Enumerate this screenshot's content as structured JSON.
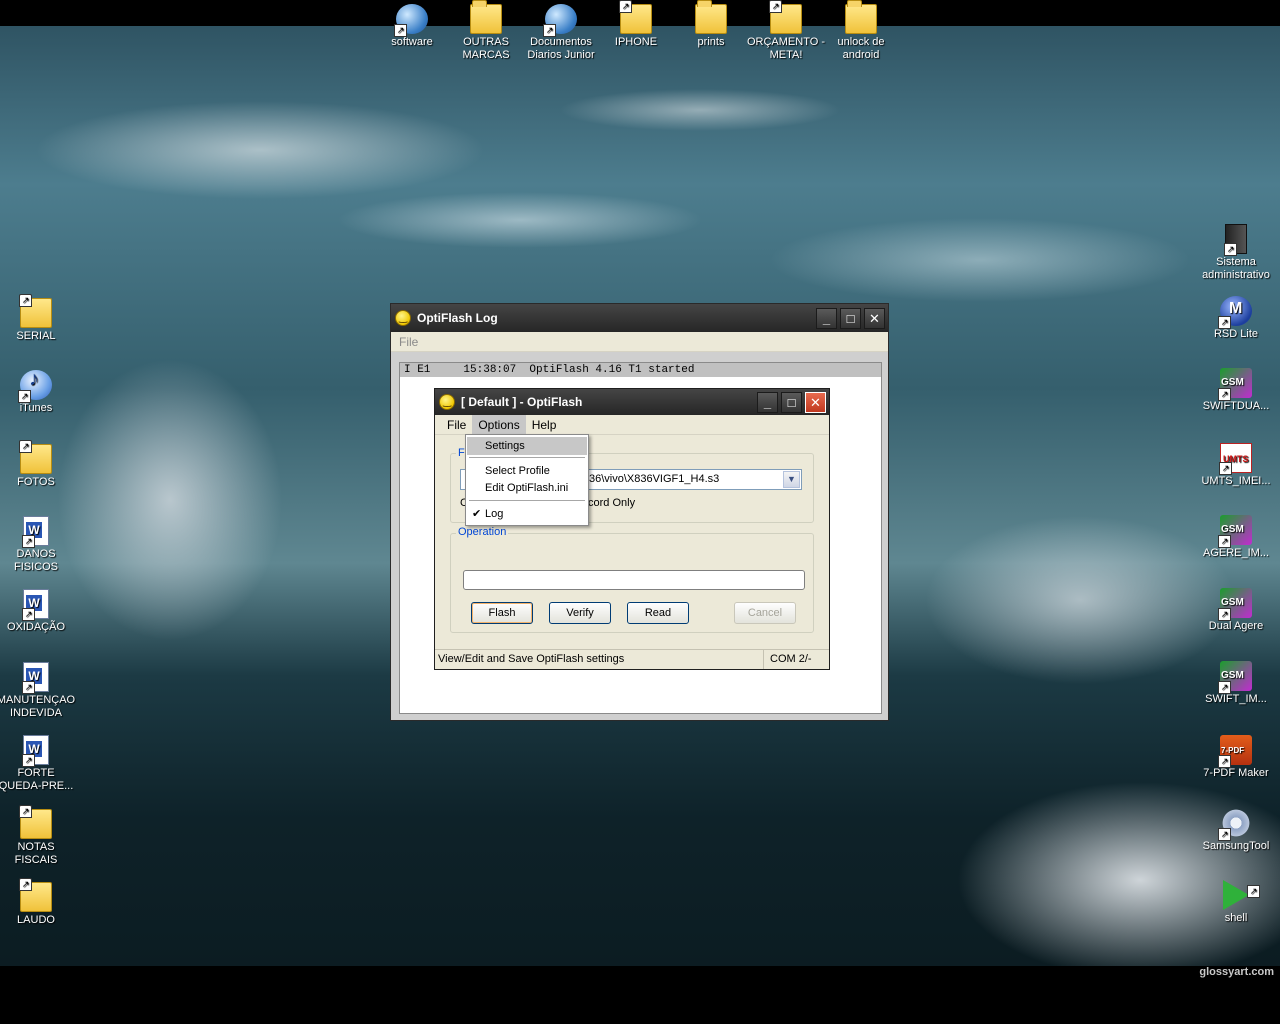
{
  "desktop": {
    "watermark": "glossyart.com",
    "top_icons": [
      {
        "label": "software",
        "icon": "globe"
      },
      {
        "label": "OUTRAS MARCAS",
        "icon": "folder"
      },
      {
        "label": "Documentos Diarios Junior",
        "icon": "globe"
      },
      {
        "label": "IPHONE",
        "icon": "folder"
      },
      {
        "label": "prints",
        "icon": "folder"
      },
      {
        "label": "ORÇAMENTO - META!",
        "icon": "folder"
      },
      {
        "label": "unlock de android",
        "icon": "folder"
      }
    ],
    "left_icons": [
      {
        "label": "SERIAL",
        "icon": "folder"
      },
      {
        "label": "iTunes",
        "icon": "itunes"
      },
      {
        "label": "FOTOS",
        "icon": "folder"
      },
      {
        "label": "DANOS FISICOS",
        "icon": "word-doc"
      },
      {
        "label": "OXIDAÇÃO",
        "icon": "word-doc"
      },
      {
        "label": "MANUTENÇAO INDEVIDA",
        "icon": "word-doc"
      },
      {
        "label": "FORTE QUEDA-PRE...",
        "icon": "word-doc"
      },
      {
        "label": "NOTAS FISCAIS",
        "icon": "folder"
      },
      {
        "label": "LAUDO",
        "icon": "folder"
      }
    ],
    "right_icons": [
      {
        "label": "Sistema administrativo",
        "icon": "computer"
      },
      {
        "label": "RSD Lite",
        "icon": "motorola"
      },
      {
        "label": "SWIFTDUA...",
        "icon": "gsm"
      },
      {
        "label": "UMTS_IMEI...",
        "icon": "umts"
      },
      {
        "label": "AGERE_IM...",
        "icon": "gsm"
      },
      {
        "label": "Dual Agere",
        "icon": "gsm"
      },
      {
        "label": "SWIFT_IM...",
        "icon": "gsm"
      },
      {
        "label": "7-PDF Maker",
        "icon": "pdf"
      },
      {
        "label": "SamsungTool",
        "icon": "gear"
      },
      {
        "label": "shell",
        "icon": "play"
      }
    ]
  },
  "log_window": {
    "title": "OptiFlash Log",
    "menu": {
      "file": "File"
    },
    "log_lines": [
      "I E1     15:38:07  OptiFlash 4.16 T1 started"
    ]
  },
  "main_window": {
    "title": "[ Default ] - OptiFlash",
    "menu": {
      "file": "File",
      "options": "Options",
      "help": "Help"
    },
    "file_group_label": "F",
    "file_path": "36\\vivo\\X836VIGF1_H4.s3",
    "record_only_fragment": "cord Only",
    "operation_group_label": "Operation",
    "buttons": {
      "flash": "Flash",
      "verify": "Verify",
      "read": "Read",
      "cancel": "Cancel"
    },
    "status_text": "View/Edit and Save OptiFlash settings",
    "status_port": "COM 2/-"
  },
  "options_menu": {
    "items": [
      "Settings",
      "Select Profile",
      "Edit OptiFlash.ini",
      "Log"
    ],
    "highlighted": "Settings",
    "checked": "Log"
  }
}
